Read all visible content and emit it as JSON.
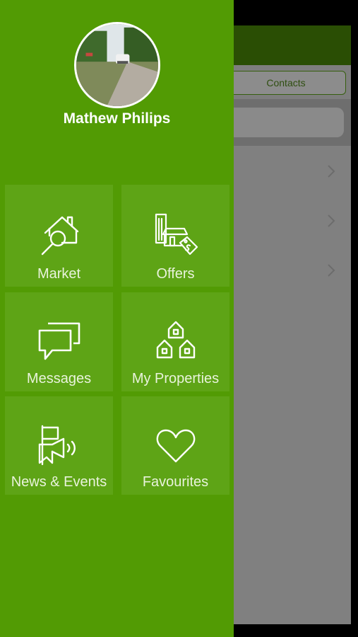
{
  "background": {
    "tab_label": "Contacts"
  },
  "drawer": {
    "user_name": "Mathew Philips",
    "menu": [
      {
        "label": "Market",
        "icon": "house-search-icon"
      },
      {
        "label": "Offers",
        "icon": "shop-price-tag-icon"
      },
      {
        "label": "Messages",
        "icon": "chat-bubbles-icon"
      },
      {
        "label": "My Properties",
        "icon": "houses-icon"
      },
      {
        "label": "News & Events",
        "icon": "flag-megaphone-icon"
      },
      {
        "label": "Favourites",
        "icon": "heart-icon"
      }
    ]
  },
  "colors": {
    "drawer": "#529b04",
    "tile": "#5ea416",
    "header": "#2a4e04"
  }
}
